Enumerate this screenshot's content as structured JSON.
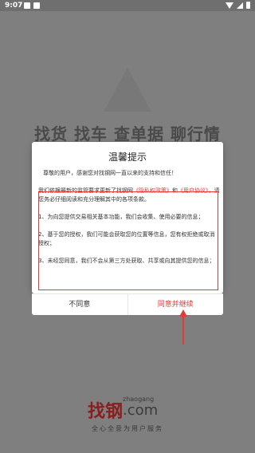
{
  "status_bar": {
    "time": "9:07"
  },
  "splash": {
    "slogan": "找货 找车 查单据 聊行情",
    "brand_cn": "找钢",
    "brand_en": "zhaogang",
    "brand_com": ".com",
    "tagline": "全心全意为用户服务"
  },
  "dialog": {
    "title": "温馨提示",
    "intro": "尊敬的用户，感谢您对找钢网一直以来的支持和信任！",
    "p1_a": "我们依据最新的监管要求更新了找钢网",
    "privacy_link": "《隐私权政策》",
    "p1_b": "和",
    "user_link": "《用户协议》",
    "p1_c": "，请您务必仔细阅读和充分理解其中的各项条款。",
    "item1": "1、为向您提供交易相关基本功能，我们会收集、使用必要的信息；",
    "item2": "2、基于您的授权，我们可能会获取您的位置等信息，您有权拒绝或取消授权；",
    "item3": "3、未经您同意，我们不会从第三方处获取、共享或向其提供您的信息；",
    "disagree": "不同意",
    "agree": "同意并继续"
  },
  "colors": {
    "accent": "#e53935"
  }
}
